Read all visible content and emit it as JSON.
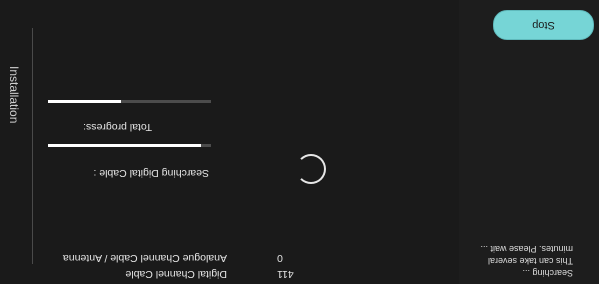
{
  "sidebar": {
    "title": "Installation"
  },
  "header": {
    "stop_label": "Stop"
  },
  "status": {
    "line1": "Searching ...",
    "line2": "This can take several",
    "line3": "minutes. Please wait ..."
  },
  "progress": {
    "digital_label": "Searching Digital Cable :",
    "digital_fraction": 0.94,
    "total_label": "Total progress:",
    "total_fraction": 0.45
  },
  "channels": [
    {
      "name": "Digital Channel Cable",
      "count": "411"
    },
    {
      "name": "Analogue Channel Cable / Antenna",
      "count": "0"
    }
  ],
  "colors": {
    "accent": "#76d5d6",
    "background": "#1a1a1a"
  },
  "icons": {
    "spinner": "loading-spinner-icon"
  }
}
